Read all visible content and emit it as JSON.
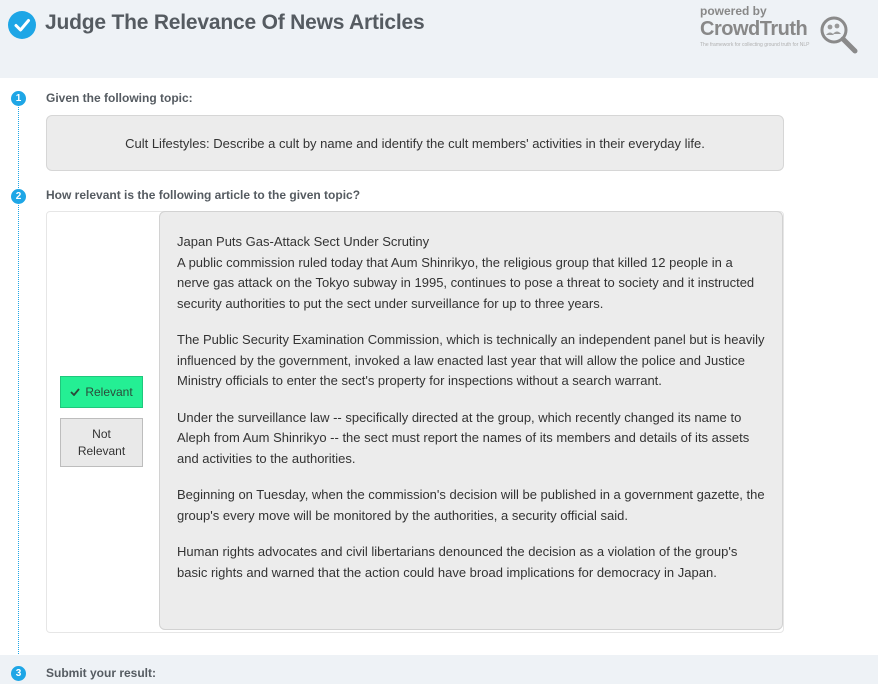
{
  "header": {
    "title": "Judge The Relevance Of News Articles",
    "brand_powered": "powered by",
    "brand_name": "CrowdTruth",
    "brand_tagline": "The framework for collecting ground truth for NLP"
  },
  "steps": [
    {
      "number": "1",
      "label": "Given the following topic:"
    },
    {
      "number": "2",
      "label": "How relevant is the following article to the given topic?"
    },
    {
      "number": "3",
      "label": "Submit your result:"
    }
  ],
  "topic": "Cult Lifestyles: Describe a cult by name and identify the cult members' activities in their everyday life.",
  "buttons": {
    "relevant": "Relevant",
    "not_relevant_line1": "Not",
    "not_relevant_line2": "Relevant",
    "selected": "relevant"
  },
  "article": {
    "title": "Japan Puts Gas-Attack Sect Under Scrutiny",
    "paragraphs": [
      "A public commission ruled today that Aum Shinrikyo, the religious group that killed 12 people in a nerve gas attack on the Tokyo subway in 1995, continues to pose a threat to society and it instructed security authorities to put the sect under surveillance for up to three years.",
      "The Public Security Examination Commission, which is technically an independent panel but is heavily influenced by the government, invoked a law enacted last year that will allow the police and Justice Ministry officials to enter the sect's property for inspections without a search warrant.",
      "Under the surveillance law -- specifically directed at the group, which recently changed its name to Aleph from Aum Shinrikyo -- the sect must report the names of its members and details of its assets and activities to the authorities.",
      "Beginning on Tuesday, when the commission's decision will be published in a government gazette, the group's every move will be monitored by the authorities, a security official said.",
      "Human rights advocates and civil libertarians denounced the decision as a violation of the group's basic rights and warned that the action could have broad implications for democracy in Japan."
    ]
  },
  "colors": {
    "accent": "#1ea6e6",
    "relevant_selected": "#24ef94",
    "header_bg": "#eef2f6",
    "box_bg": "#ececec"
  },
  "icons": {
    "header": "check-circle-icon",
    "brand": "magnifier-logo-icon",
    "relevant": "check-icon"
  }
}
